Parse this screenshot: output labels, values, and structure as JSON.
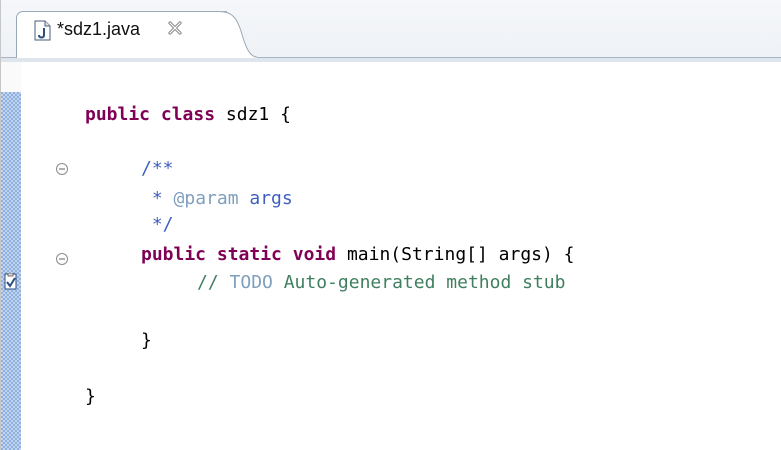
{
  "editor": {
    "tab": {
      "title": "*sdz1.java",
      "file_icon": "java-file-icon",
      "close_icon": "close-icon"
    },
    "code": {
      "line1": {
        "keyword1": "public",
        "keyword2": "class",
        "rest": " sdz1 {"
      },
      "line2": {
        "text": "/**"
      },
      "line3": {
        "prefix": " * ",
        "tag": "@param",
        "rest": " args"
      },
      "line4": {
        "text": " */"
      },
      "line5": {
        "kw1": "public",
        "kw2": "static",
        "kw3": "void",
        "rest": " main(String[] args) {"
      },
      "line6": {
        "slashes": "// ",
        "todo": "TODO",
        "rest": " Auto-generated method stub"
      },
      "line7": {
        "text": "}"
      },
      "line8": {
        "text": "}"
      }
    },
    "gutter": {
      "fold_icon": "collapse-icon",
      "task_icon": "task-marker-icon"
    },
    "colors": {
      "keyword": "#7f0055",
      "javadoc": "#3f5fbf",
      "javadoc_tag": "#7f9fbf",
      "comment": "#3f7f5f",
      "ruler_range": "#8fb1df"
    }
  }
}
